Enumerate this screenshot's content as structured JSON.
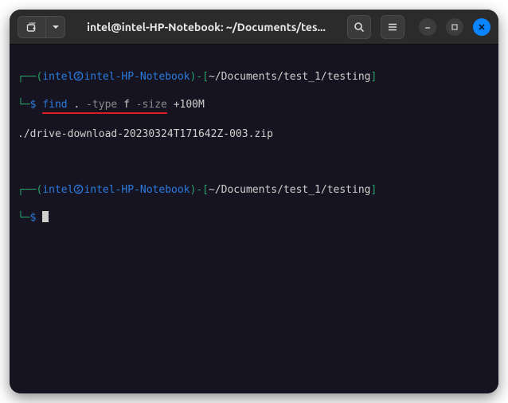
{
  "window": {
    "title": "intel@intel-HP-Notebook: ~/Documents/tes..."
  },
  "prompt": {
    "user": "intel",
    "host": "intel-HP-Notebook",
    "sep_open": "(",
    "at": "@",
    "sep_close": ")-",
    "path_open": "[",
    "path": "~/Documents/test_1/testing",
    "path_close": "]",
    "corner_top": "┌──",
    "corner_bottom": "└─",
    "symbol": "$"
  },
  "command": {
    "cmd": "find",
    "arg_path": ".",
    "flag_type": "-type",
    "val_type": "f",
    "flag_size": "-size",
    "val_size": "+100M"
  },
  "output": {
    "line1": "./drive-download-20230324T171642Z-003.zip"
  },
  "icons": {
    "newtab": "new-tab-icon",
    "dropdown": "chevron-down-icon",
    "search": "search-icon",
    "menu": "hamburger-icon",
    "minimize": "minimize-icon",
    "maximize": "maximize-icon",
    "close": "close-icon",
    "shell": "shell-icon"
  }
}
